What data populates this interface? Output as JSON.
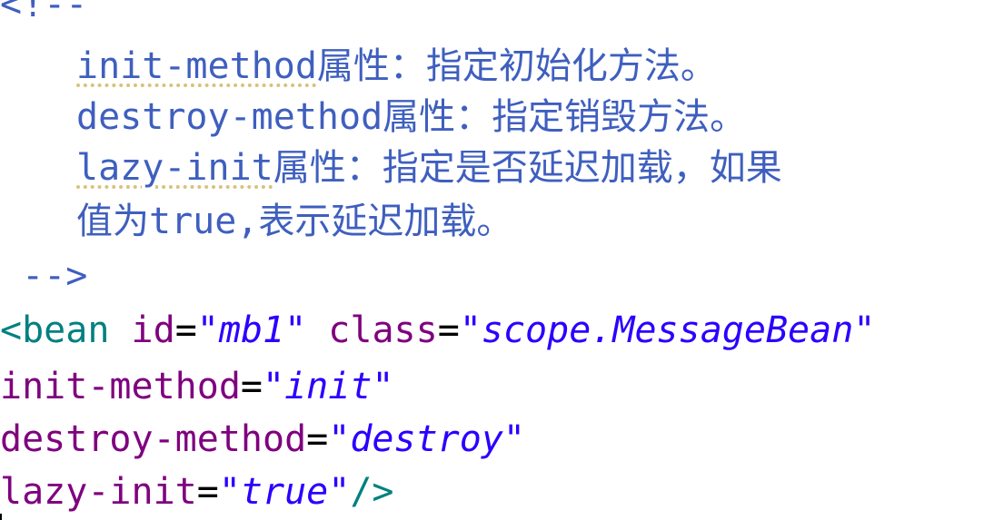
{
  "editor": {
    "comment_open": "<!--",
    "comment_lines": [
      {
        "keyword": "init-method",
        "text": "属性：指定初始化方法。"
      },
      {
        "keyword": "destroy-method",
        "text": "属性：指定销毁方法。"
      },
      {
        "keyword": "lazy-init",
        "text": "属性：指定是否延迟加载，如果"
      }
    ],
    "comment_line4_prefix": "值为",
    "comment_line4_keyword": "true,",
    "comment_line4_suffix": "表示延迟加载。",
    "comment_close": " -->",
    "bean_tag_open": "<bean",
    "attr_id": "id",
    "attr_id_value": "\"mb1\"",
    "attr_class": "class",
    "attr_class_value": "\"scope.MessageBean\"",
    "attr_init": "init-method",
    "attr_init_value": "\"init\"",
    "attr_destroy": "destroy-method",
    "attr_destroy_value": "\"destroy\"",
    "attr_lazy": "lazy-init",
    "attr_lazy_value": "\"true\"",
    "equals": "=",
    "tag_close": "/>"
  }
}
